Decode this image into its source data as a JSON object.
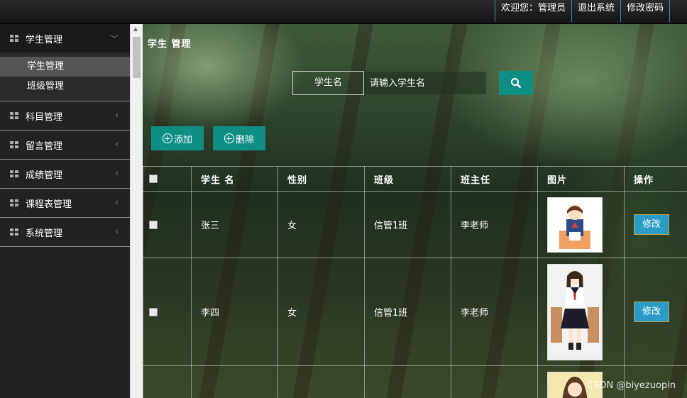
{
  "topbar": {
    "welcome": "欢迎您：管理员",
    "logout": "退出系统",
    "change_password": "修改密码"
  },
  "sidebar": {
    "groups": [
      {
        "label": "学生管理",
        "expanded": true,
        "items": [
          "学生管理",
          "班级管理"
        ],
        "active_item": "学生管理"
      },
      {
        "label": "科目管理",
        "expanded": false
      },
      {
        "label": "留言管理",
        "expanded": false
      },
      {
        "label": "成绩管理",
        "expanded": false
      },
      {
        "label": "课程表管理",
        "expanded": false
      },
      {
        "label": "系统管理",
        "expanded": false
      }
    ]
  },
  "main": {
    "title": "学生 管理",
    "search": {
      "label": "学生名",
      "placeholder": "请输入学生名"
    },
    "buttons": {
      "add": "添加",
      "delete": "删除"
    },
    "table": {
      "headers": [
        "学生 名",
        "性别",
        "班级",
        "班主任",
        "图片",
        "操作"
      ],
      "rows": [
        {
          "name": "张三",
          "gender": "女",
          "class": "信管1班",
          "teacher": "李老师",
          "action": "修改"
        },
        {
          "name": "李四",
          "gender": "女",
          "class": "信管1班",
          "teacher": "李老师",
          "action": "修改"
        },
        {
          "name": "",
          "gender": "",
          "class": "",
          "teacher": "",
          "action": ""
        }
      ]
    }
  },
  "watermark": "CSDN @biyezuopin",
  "colors": {
    "accent": "#0f8f84",
    "edit_button": "#2a9cc6",
    "topbar_border": "#3a89b3"
  }
}
